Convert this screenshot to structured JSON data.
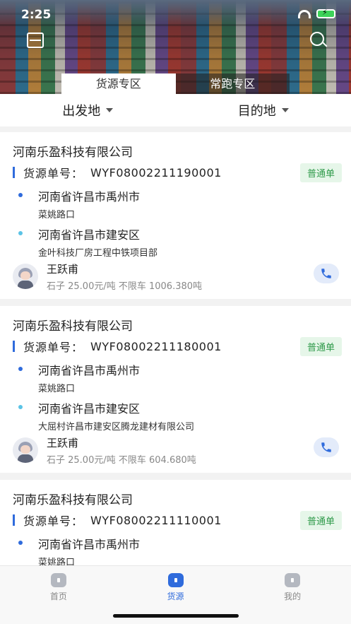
{
  "status_bar": {
    "time": "2:25"
  },
  "header": {
    "tabs": [
      {
        "label": "货源专区",
        "active": true
      },
      {
        "label": "常跑专区",
        "active": false
      }
    ]
  },
  "filters": {
    "origin": "出发地",
    "destination": "目的地"
  },
  "cargo_list": [
    {
      "company": "河南乐盈科技有限公司",
      "order_label": "货源单号：",
      "order_no": "WYF08002211190001",
      "badge": "普通单",
      "from_city": "河南省许昌市禹州市",
      "from_addr": "菜姚路口",
      "to_city": "河南省许昌市建安区",
      "to_addr": "金叶科技厂房工程中铁项目部",
      "person": "王跃甫",
      "info": "石子 25.00元/吨 不限车 1006.380吨"
    },
    {
      "company": "河南乐盈科技有限公司",
      "order_label": "货源单号：",
      "order_no": "WYF08002211180001",
      "badge": "普通单",
      "from_city": "河南省许昌市禹州市",
      "from_addr": "菜姚路口",
      "to_city": "河南省许昌市建安区",
      "to_addr": "大屈村许昌市建安区腾龙建材有限公司",
      "person": "王跃甫",
      "info": "石子 25.00元/吨 不限车 604.680吨"
    },
    {
      "company": "河南乐盈科技有限公司",
      "order_label": "货源单号：",
      "order_no": "WYF08002211110001",
      "badge": "普通单",
      "from_city": "河南省许昌市禹州市",
      "from_addr": "菜姚路口"
    }
  ],
  "tabbar": {
    "home": "首页",
    "cargo": "货源",
    "mine": "我的"
  },
  "colors": {
    "accent": "#2f6bdc",
    "badge_bg": "#e6f6e9",
    "badge_text": "#2f9a4a"
  }
}
